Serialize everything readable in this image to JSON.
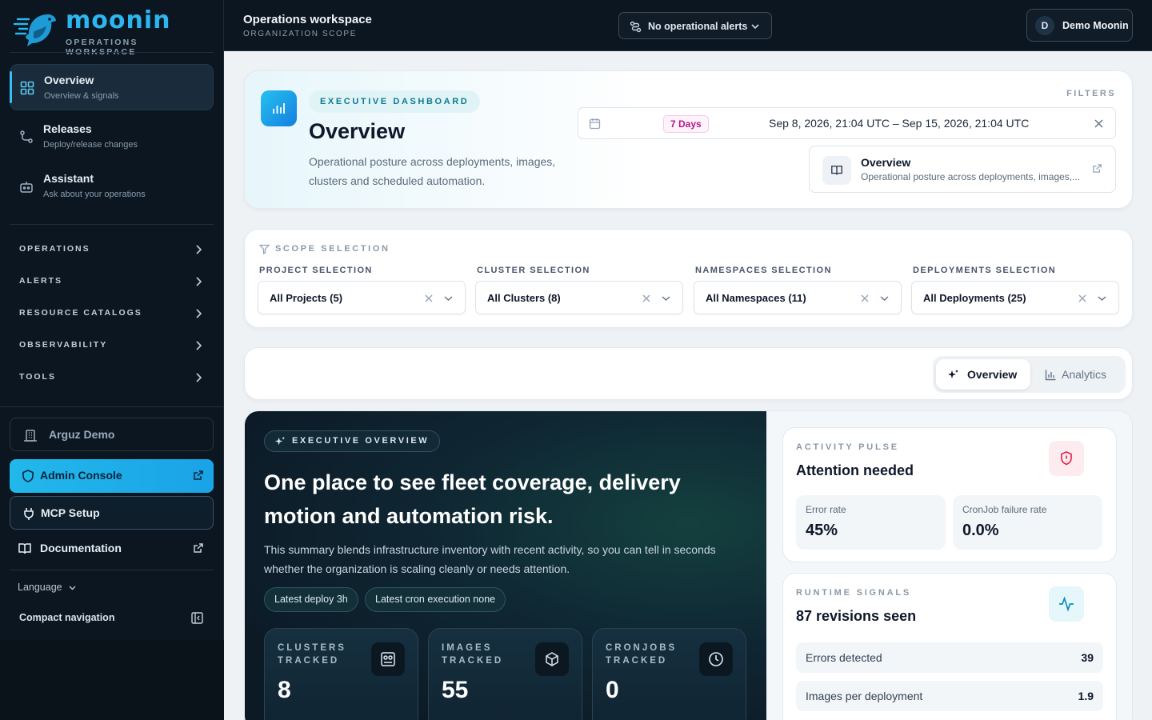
{
  "brand": {
    "name": "moonin",
    "subtitle": "OPERATIONS WORKSPACE"
  },
  "sidebar": {
    "primary": [
      {
        "title": "Overview",
        "subtitle": "Overview & signals"
      },
      {
        "title": "Releases",
        "subtitle": "Deploy/release changes"
      },
      {
        "title": "Assistant",
        "subtitle": "Ask about your operations"
      }
    ],
    "sections": [
      "OPERATIONS",
      "ALERTS",
      "RESOURCE CATALOGS",
      "OBSERVABILITY",
      "TOOLS"
    ],
    "org": "Arguz Demo",
    "admin": "Admin Console",
    "mcp": "MCP Setup",
    "docs": "Documentation",
    "language": "Language",
    "compact": "Compact navigation"
  },
  "topbar": {
    "title": "Operations workspace",
    "subtitle": "ORGANIZATION SCOPE",
    "alerts": "No operational alerts",
    "user_initial": "D",
    "user_name": "Demo Moonin"
  },
  "hero": {
    "chip": "EXECUTIVE DASHBOARD",
    "title": "Overview",
    "description": "Operational posture across deployments, images, clusters and scheduled automation.",
    "filters_label": "FILTERS",
    "range_badge": "7 Days",
    "range": "Sep 8, 2026, 21:04 UTC – Sep 15, 2026, 21:04 UTC",
    "doc_title": "Overview",
    "doc_subtitle": "Operational posture across deployments, images,..."
  },
  "scope": {
    "label": "SCOPE SELECTION",
    "groups": [
      {
        "label": "PROJECT SELECTION",
        "value": "All Projects (5)"
      },
      {
        "label": "CLUSTER SELECTION",
        "value": "All Clusters (8)"
      },
      {
        "label": "NAMESPACES SELECTION",
        "value": "All Namespaces (11)"
      },
      {
        "label": "DEPLOYMENTS SELECTION",
        "value": "All Deployments (25)"
      }
    ]
  },
  "tabs": [
    {
      "label": "Overview",
      "active": true
    },
    {
      "label": "Analytics",
      "active": false
    }
  ],
  "executive": {
    "chip": "EXECUTIVE OVERVIEW",
    "headline": "One place to see fleet coverage, delivery motion and automation risk.",
    "description": "This summary blends infrastructure inventory with recent activity, so you can tell in seconds whether the organization is scaling cleanly or needs attention.",
    "pills": [
      "Latest deploy 3h",
      "Latest cron execution none"
    ],
    "metrics": [
      {
        "label": "CLUSTERS TRACKED",
        "value": "8",
        "icon": "cluster-icon"
      },
      {
        "label": "IMAGES TRACKED",
        "value": "55",
        "icon": "cube-icon"
      },
      {
        "label": "CRONJOBS TRACKED",
        "value": "0",
        "icon": "clock-icon"
      }
    ]
  },
  "pulse": {
    "kicker": "ACTIVITY PULSE",
    "title": "Attention needed",
    "stats": [
      {
        "label": "Error rate",
        "value": "45%"
      },
      {
        "label": "CronJob failure rate",
        "value": "0.0%"
      }
    ]
  },
  "runtime": {
    "kicker": "RUNTIME SIGNALS",
    "title": "87 revisions seen",
    "rows": [
      {
        "label": "Errors detected",
        "value": "39"
      },
      {
        "label": "Images per deployment",
        "value": "1.9"
      }
    ]
  },
  "colors": {
    "accent": "#22b8ea",
    "sidebar_bg": "#0b1620",
    "danger": "#e11d48",
    "badge": "#b0198a"
  }
}
